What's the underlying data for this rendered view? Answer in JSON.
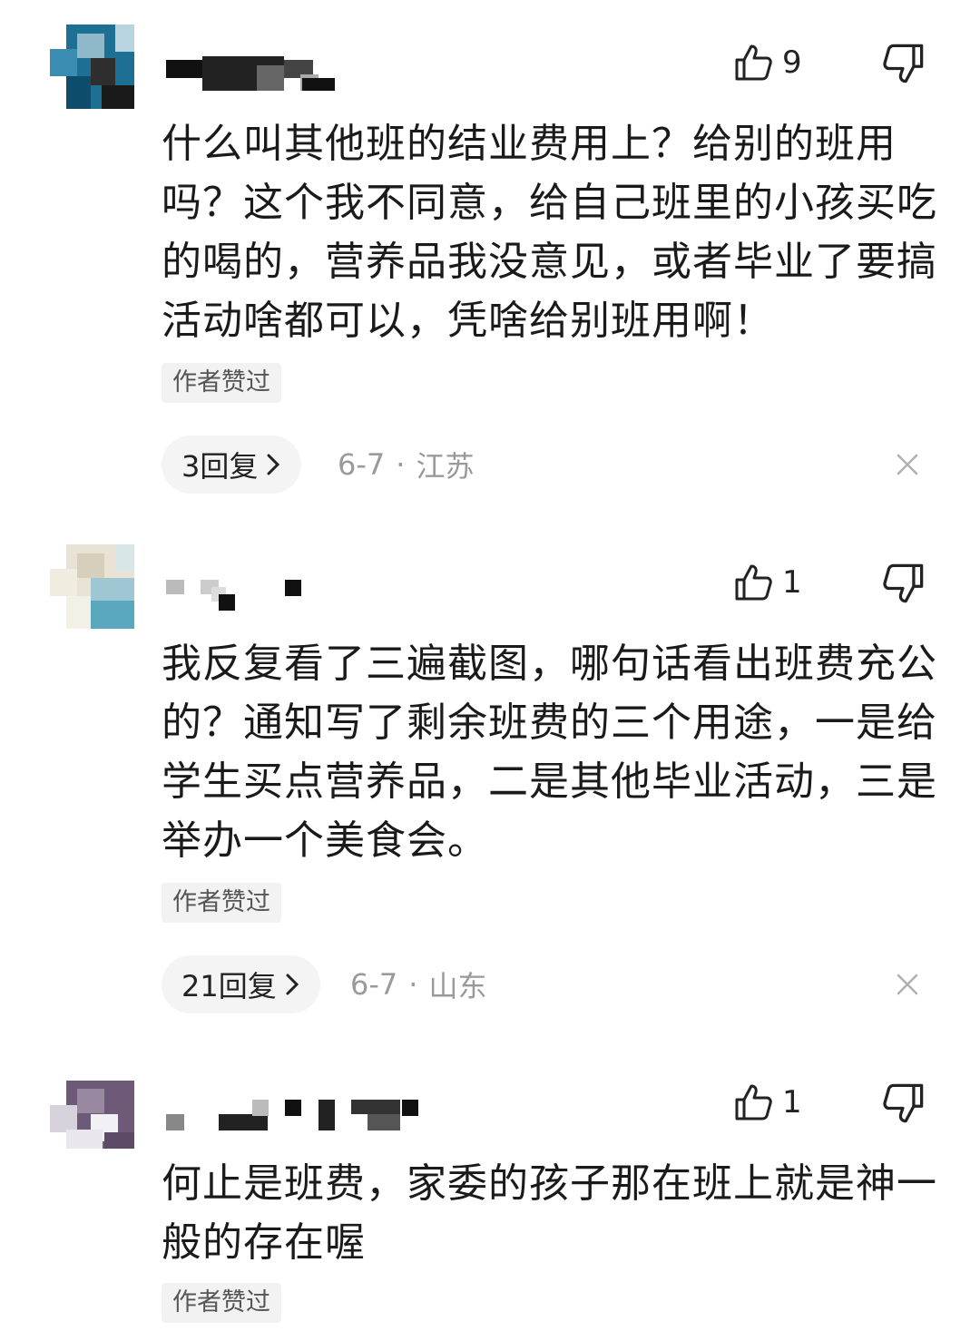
{
  "comments": [
    {
      "likes": "9",
      "text": "什么叫其他班的结业费用上？给别的班用吗？这个我不同意，给自己班里的小孩买吃的喝的，营养品我没意见，或者毕业了要搞活动啥都可以，凭啥给别班用啊！",
      "badge": "作者赞过",
      "replies": "3回复",
      "date": "6-7",
      "separator": "·",
      "location": "江苏"
    },
    {
      "likes": "1",
      "text": "我反复看了三遍截图，哪句话看出班费充公的？通知写了剩余班费的三个用途，一是给学生买点营养品，二是其他毕业活动，三是举办一个美食会。",
      "badge": "作者赞过",
      "replies": "21回复",
      "date": "6-7",
      "separator": "·",
      "location": "山东"
    },
    {
      "likes": "1",
      "text": "何止是班费，家委的孩子那在班上就是神一般的存在喔",
      "badge": "作者赞过"
    }
  ],
  "icons": {
    "like": "thumbs-up-icon",
    "dislike": "thumbs-down-icon",
    "chevron": "chevron-right-icon",
    "close": "close-icon"
  },
  "colors": {
    "text": "#1a1a1a",
    "meta": "#9a9a9a",
    "badge_bg": "#f2f2f2",
    "pill_bg": "#f4f4f4"
  }
}
